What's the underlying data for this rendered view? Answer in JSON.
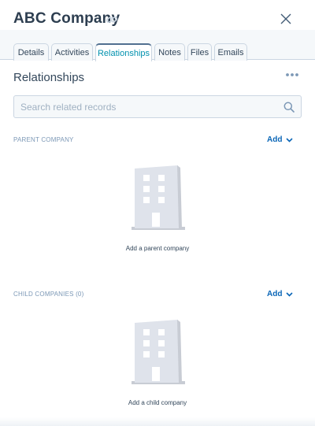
{
  "header": {
    "title": "ABC Company"
  },
  "tabs": [
    {
      "label": "Details",
      "active": false
    },
    {
      "label": "Activities",
      "active": false
    },
    {
      "label": "Relationships",
      "active": true
    },
    {
      "label": "Notes",
      "active": false
    },
    {
      "label": "Files",
      "active": false
    },
    {
      "label": "Emails",
      "active": false
    }
  ],
  "section": {
    "title": "Relationships"
  },
  "search": {
    "placeholder": "Search related records",
    "value": ""
  },
  "parent": {
    "label": "PARENT COMPANY",
    "add_label": "Add",
    "empty_text": "Add a parent company"
  },
  "child": {
    "label": "CHILD COMPANIES (0)",
    "add_label": "Add",
    "empty_text": "Add a child company"
  },
  "colors": {
    "accent": "#0a66b7",
    "active_tab_text": "#0091ae",
    "tab_bg": "#f5f8fa",
    "illustration": "#dfe3eb"
  },
  "icons": [
    "link-icon",
    "close-icon",
    "more-icon",
    "search-icon",
    "chevron-down-icon",
    "building-icon"
  ]
}
